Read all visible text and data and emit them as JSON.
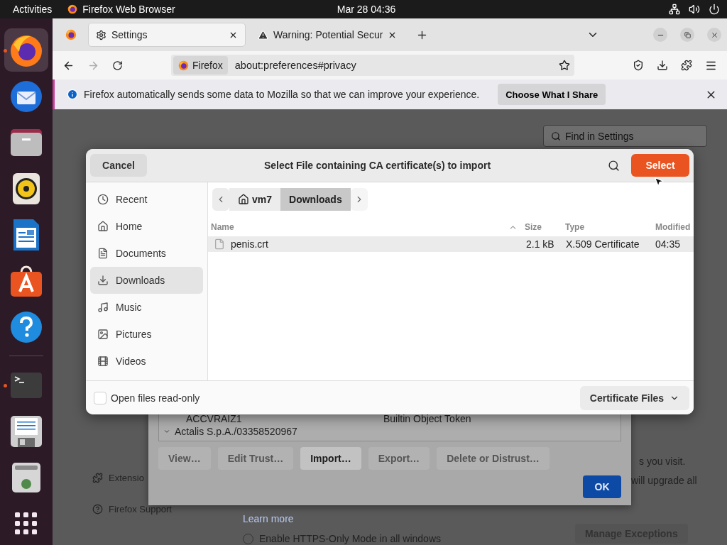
{
  "top_bar": {
    "activities": "Activities",
    "app_name": "Firefox Web Browser",
    "clock": "Mar 28  04:36"
  },
  "dock": [
    {
      "kind": "browser",
      "selected": true,
      "running": true
    },
    {
      "kind": "mail",
      "selected": false,
      "running": false
    },
    {
      "kind": "folder",
      "selected": false,
      "running": false
    },
    {
      "kind": "speaker",
      "selected": false,
      "running": false
    },
    {
      "kind": "document",
      "selected": false,
      "running": false
    },
    {
      "kind": "store",
      "selected": false,
      "running": false
    },
    {
      "kind": "help",
      "selected": false,
      "running": false
    },
    {
      "kind": "separator"
    },
    {
      "kind": "terminal",
      "selected": false,
      "running": true
    },
    {
      "kind": "floppy",
      "selected": false,
      "running": false
    },
    {
      "kind": "drive",
      "selected": false,
      "running": false
    },
    {
      "kind": "grid",
      "selected": false,
      "running": false
    }
  ],
  "tabs": [
    {
      "title": "Settings",
      "kind": "settings",
      "selected": true
    },
    {
      "title": "Warning: Potential Secur",
      "kind": "warning",
      "selected": false
    }
  ],
  "address_bar": {
    "identity": "Firefox",
    "url": "about:preferences#privacy"
  },
  "notification": {
    "message": "Firefox automatically sends some data to Mozilla so that we can improve your experience.",
    "button": "Choose What I Share"
  },
  "settings_page": {
    "search_placeholder": "Find in Settings",
    "sidebar": [
      {
        "label": "Extensio",
        "kind": "puzzle"
      },
      {
        "label": "Firefox Support",
        "kind": "help"
      }
    ],
    "texts": [
      "s you visit.",
      "will upgrade all"
    ],
    "learn_more": "Learn more",
    "https_option": {
      "label": "Enable HTTPS-Only Mode in all windows",
      "selected": false
    },
    "manage_exceptions": "Manage Exceptions"
  },
  "certificate_manager": {
    "rows": [
      {
        "name": "ACCVRAIZ1",
        "device": "Builtin Object Token"
      },
      {
        "name": "Actalis S.p.A./03358520967",
        "expanded": true
      }
    ],
    "buttons": [
      {
        "label": "View…",
        "disabled": true
      },
      {
        "label": "Edit Trust…",
        "disabled": true
      },
      {
        "label": "Import…",
        "disabled": false
      },
      {
        "label": "Export…",
        "disabled": true
      },
      {
        "label": "Delete or Distrust…",
        "disabled": true
      }
    ],
    "ok": "OK"
  },
  "file_dialog": {
    "cancel": "Cancel",
    "title": "Select File containing CA certificate(s) to import",
    "select": "Select",
    "places": [
      {
        "label": "Recent",
        "kind": "recent",
        "selected": false
      },
      {
        "label": "Home",
        "kind": "home",
        "selected": false
      },
      {
        "label": "Documents",
        "kind": "documents",
        "selected": false
      },
      {
        "label": "Downloads",
        "kind": "downloads",
        "selected": true
      },
      {
        "label": "Music",
        "kind": "music",
        "selected": false
      },
      {
        "label": "Pictures",
        "kind": "pictures",
        "selected": false
      },
      {
        "label": "Videos",
        "kind": "videos",
        "selected": false
      }
    ],
    "path": [
      {
        "label": "vm7",
        "kind": "home",
        "selected": false
      },
      {
        "label": "Downloads",
        "kind": "folder",
        "selected": true
      }
    ],
    "columns": [
      "Name",
      "Size",
      "Type",
      "Modified"
    ],
    "files": [
      {
        "name": "penis.crt",
        "size": "2.1 kB",
        "type": "X.509 Certificate",
        "modified": "04:35",
        "selected": true
      }
    ],
    "read_only": {
      "label": "Open files read-only",
      "checked": false
    },
    "filter": "Certificate Files"
  }
}
